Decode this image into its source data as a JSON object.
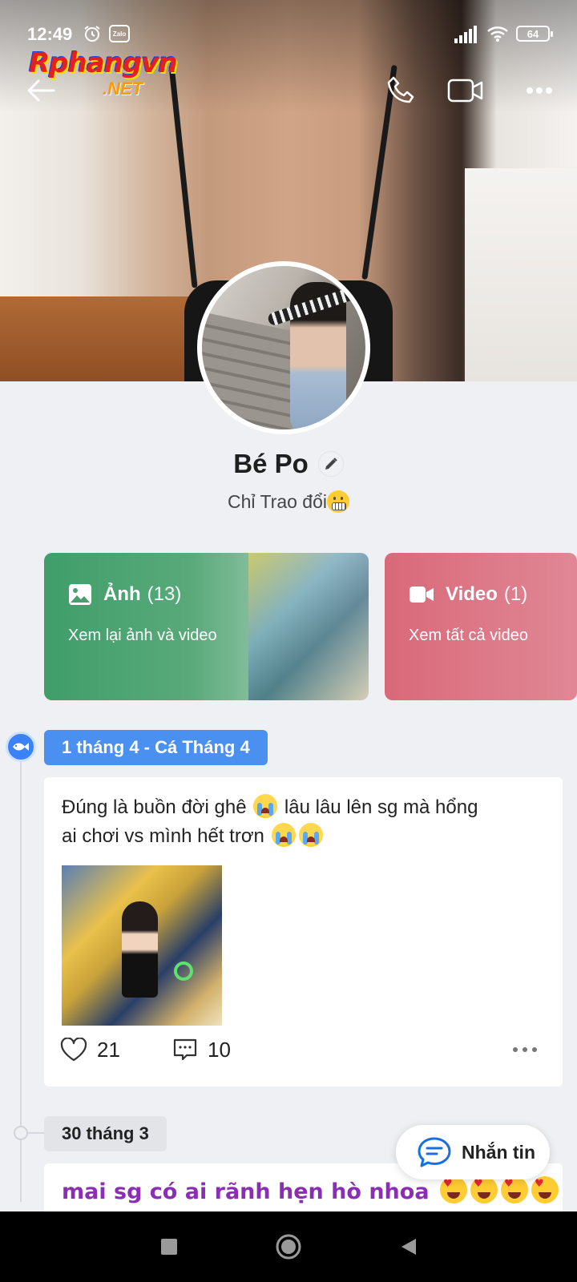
{
  "status_bar": {
    "time": "12:49",
    "zalo_badge": "Zalo",
    "battery": "64"
  },
  "watermark": {
    "brand": "Rphangvn",
    "suffix": ".NET"
  },
  "header": {
    "icons": [
      "back-arrow-icon",
      "phone-icon",
      "video-call-icon",
      "more-icon"
    ]
  },
  "profile": {
    "name": "Bé Po",
    "bio": "Chỉ Trao đổi"
  },
  "media_cards": [
    {
      "title": "Ảnh",
      "count": "(13)",
      "subtitle": "Xem lại ảnh và video",
      "color": "#3f9e6a"
    },
    {
      "title": "Video",
      "count": "(1)",
      "subtitle": "Xem tất cả video",
      "color": "#d96979"
    }
  ],
  "timeline": [
    {
      "date": "1 tháng 4 - Cá Tháng 4",
      "post_line1": "Đúng là buồn đời ghê",
      "post_line1b": " lâu lâu lên sg mà hổng",
      "post_line2": "ai chơi vs mình hết trơn",
      "likes": "21",
      "comments": "10"
    },
    {
      "date": "30 tháng 3",
      "post_text": "mai sg có ai rãnh hẹn hò nhoa"
    }
  ],
  "message_button": {
    "label": "Nhắn tin"
  },
  "colors": {
    "accent": "#4a90f0",
    "photo_card": "#3f9e6a",
    "video_card": "#d96979",
    "post2_text": "#8a2fb5"
  }
}
